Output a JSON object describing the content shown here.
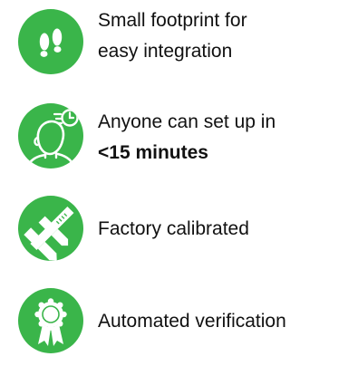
{
  "colors": {
    "accent": "#3ab54a",
    "icon_foreground": "#ffffff",
    "text": "#111111"
  },
  "features": [
    {
      "icon": "footprints-icon",
      "line1": "Small footprint for",
      "line2": "easy integration"
    },
    {
      "icon": "person-timer-icon",
      "line1": "Anyone can set up in",
      "line2": "<15 minutes"
    },
    {
      "icon": "caliper-icon",
      "line1": "Factory calibrated"
    },
    {
      "icon": "award-ribbon-icon",
      "line1": "Automated verification"
    }
  ]
}
